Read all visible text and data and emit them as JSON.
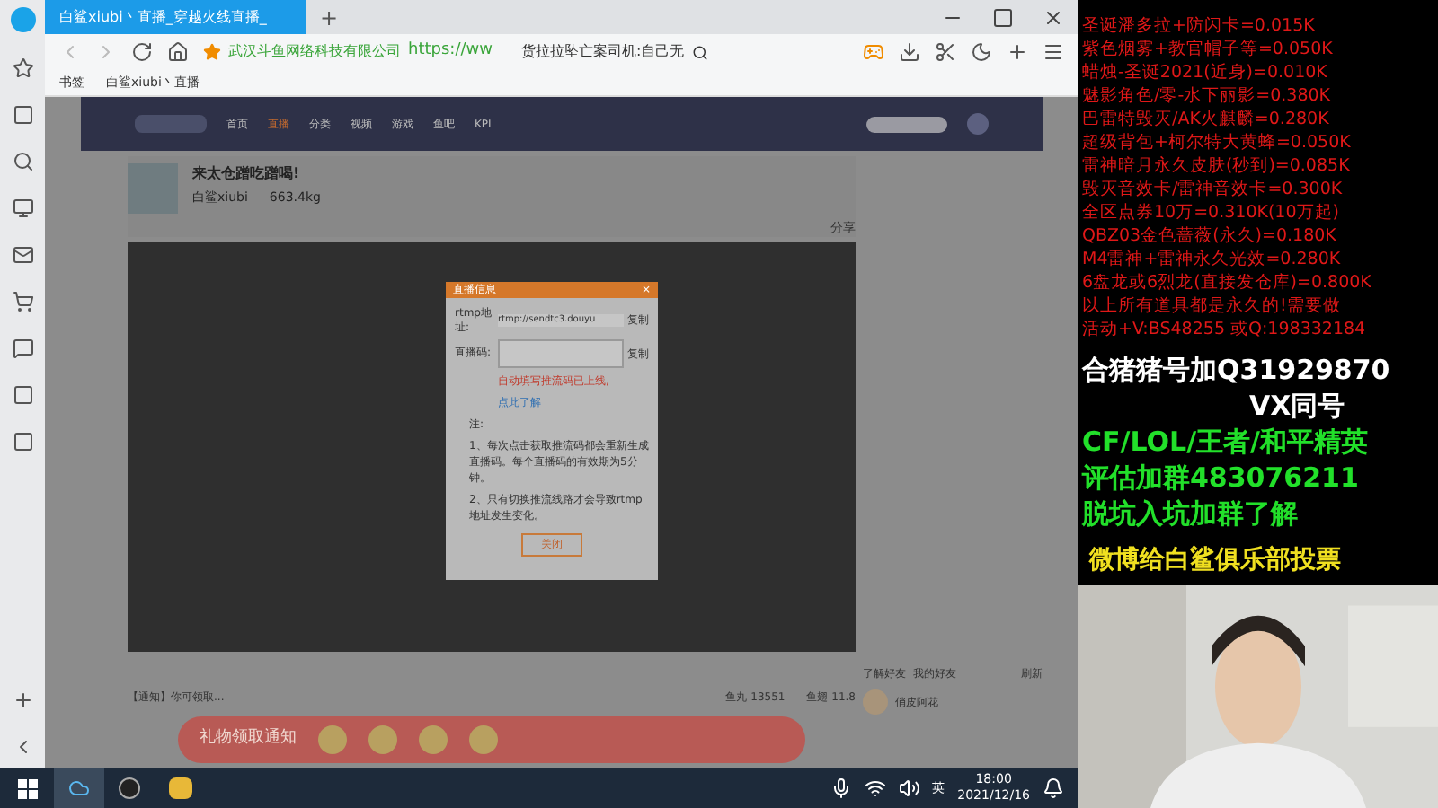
{
  "browser": {
    "tab_title": "白鲨xiubi丶直播_穿越火线直播_",
    "new_tab": "+",
    "site_owner": "武汉斗鱼网络科技有限公司",
    "url": "https://ww",
    "search_text": "货拉拉坠亡案司机:自己无",
    "bookmarks": [
      "书签",
      "白鲨xiubi丶直播"
    ]
  },
  "page": {
    "nav": [
      "首页",
      "直播",
      "分类",
      "视频",
      "游戏",
      "鱼吧",
      "KPL"
    ],
    "room_title": "来太仓蹭吃蹭喝!",
    "streamer": "白鲨xiubi",
    "weight": "663.4kg",
    "share": "分享",
    "notice": "【通知】你可领取...",
    "fish_ball": "鱼丸 13551",
    "fish_fin": "鱼翅 11.8",
    "banner": "礼物领取通知",
    "friends": "了解好友",
    "my_friends": "我的好友",
    "refresh": "刷新",
    "friend_name": "俏皮阿花"
  },
  "dialog": {
    "title": "直播信息",
    "close_x": "×",
    "rtmp_label": "rtmp地址:",
    "rtmp_value": "rtmp://sendtc3.douyu",
    "copy": [
      "复制",
      "复制"
    ],
    "code_label": "直播码:",
    "auto_notice": "自动填写推流码已上线,",
    "learn_link": "点此了解",
    "note_title": "注:",
    "notes": [
      "1、每次点击获取推流码都会重新生成直播码。每个直播码的有效期为5分钟。",
      "2、只有切换推流线路才会导致rtmp地址发生变化。"
    ],
    "close_button": "关闭"
  },
  "taskbar": {
    "ime": "英",
    "time": "18:00",
    "date": "2021/12/16"
  },
  "overlay": {
    "price_lines": [
      "圣诞潘多拉+防闪卡=0.015K",
      "紫色烟雾+教官帽子等=0.050K",
      "蜡烛-圣诞2021(近身)=0.010K",
      "魅影角色/零-水下丽影=0.380K",
      "巴雷特毁灭/AK火麒麟=0.280K",
      "超级背包+柯尔特大黄蜂=0.050K",
      "雷神暗月永久皮肤(秒到)=0.085K",
      "毁灭音效卡/雷神音效卡=0.300K",
      "全区点券10万=0.310K(10万起)",
      "QBZ03金色蔷薇(永久)=0.180K",
      "M4雷神+雷神永久光效=0.280K",
      "6盘龙或6烈龙(直接发仓库)=0.800K",
      "以上所有道具都是永久的!需要做",
      "活动+V:BS48255  或Q:198332184"
    ],
    "promo_lines": [
      {
        "text": "合猪猪号加Q31929870",
        "color": "#ffffff"
      },
      {
        "text": "VX同号",
        "color": "#ffffff"
      },
      {
        "text": "CF/LOL/王者/和平精英",
        "color": "#22e02a"
      },
      {
        "text": "评估加群483076211",
        "color": "#22e02a"
      },
      {
        "text": "脱坑入坑加群了解",
        "color": "#22e02a"
      },
      {
        "text": "微博给白鲨俱乐部投票",
        "color": "#f0e020"
      }
    ]
  }
}
